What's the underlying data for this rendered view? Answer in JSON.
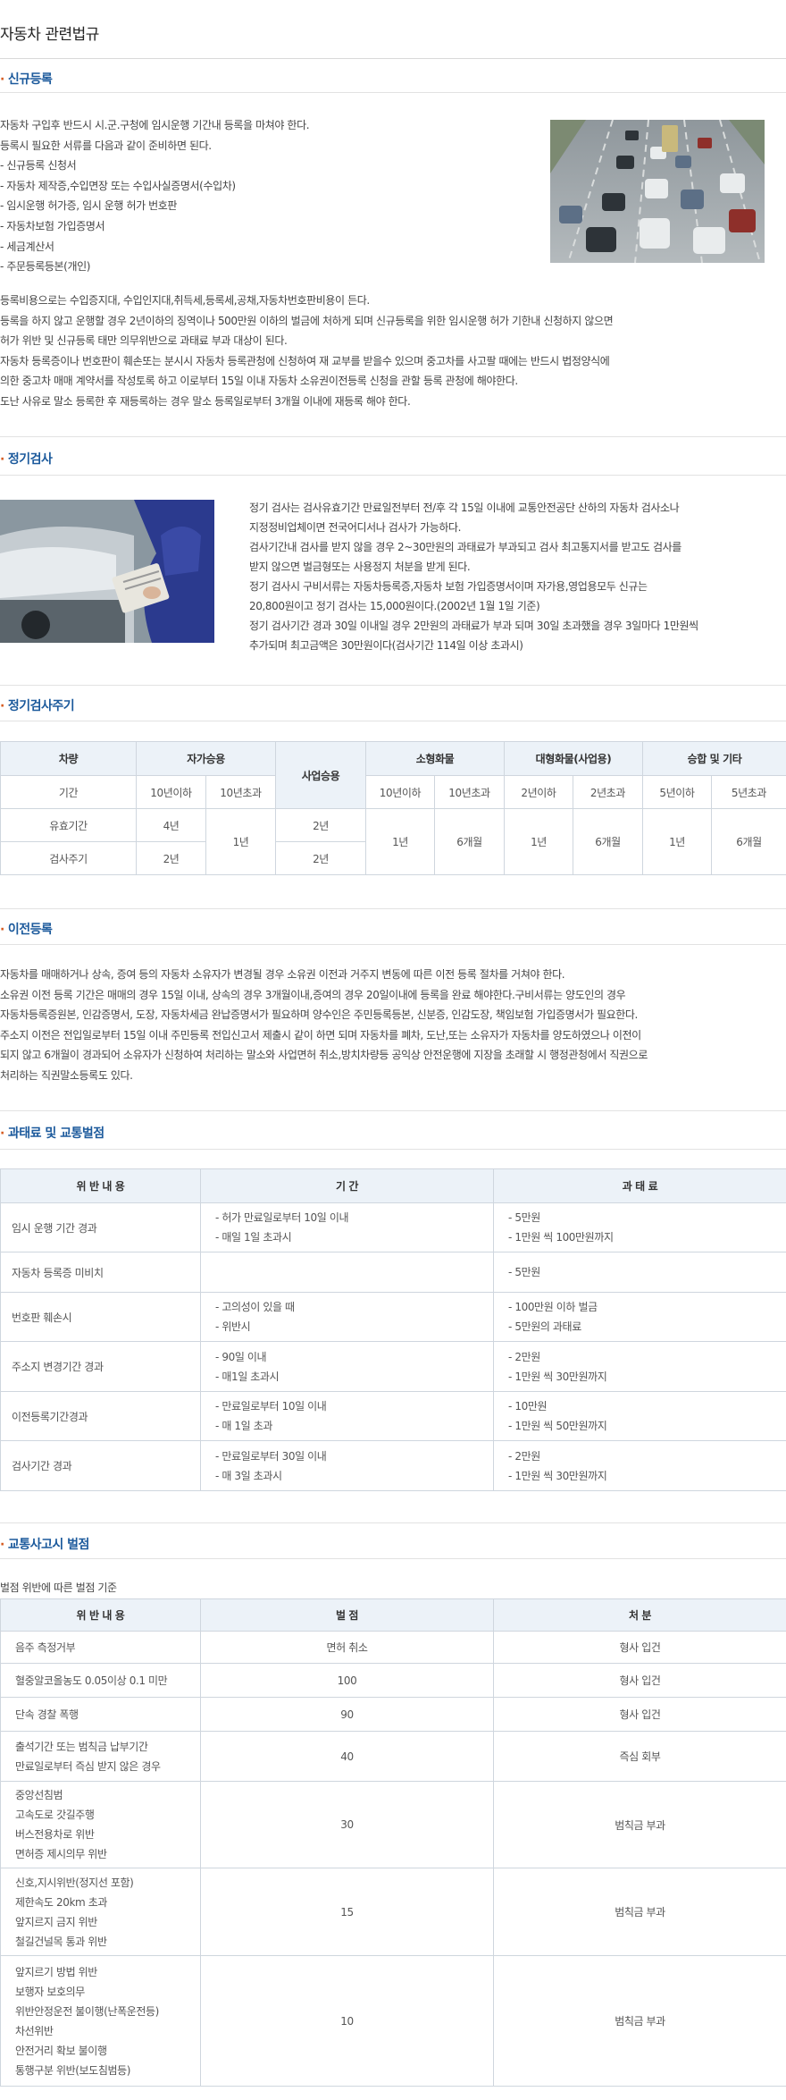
{
  "page_title": "자동차 관련법규",
  "sections": {
    "new_registration": {
      "title": "신규등록",
      "lines_top": [
        "자동차 구입후 반드시 시.군.구청에 임시운행 기간내 등록을 마쳐야 한다.",
        "등록시 필요한 서류를 다음과 같이 준비하면 된다.",
        "- 신규등록 신청서",
        "- 자동차 제작증,수입면장 또는 수입사실증명서(수입차)",
        "- 임시운행 허가증, 임시 운행 허가 번호판",
        "- 자동차보험 가입증명서",
        "- 세금계산서",
        "- 주문등록등본(개인)"
      ],
      "lines_bottom": [
        "등록비용으로는 수입증지대, 수입인지대,취득세,등록세,공채,자동차번호판비용이 든다.",
        "등록을 하지 않고 운행할 경우 2년이하의 징역이나 500만원 이하의 벌금에 처하게 되며 신규등록을 위한 임시운행 허가 기한내 신청하지 않으면",
        "허가 위반 및 신규등록 태만 의무위반으로 과태료 부과 대상이 된다.",
        "자동차 등록증이나 번호판이 훼손또는 분시시 자동차 등록관청에 신청하여 재 교부를 받을수 있으며 중고차를 사고팔 때에는 반드시 법정양식에",
        "의한 중고차 매매 계약서를 작성토록 하고 이로부터 15일 이내 자동차 소유권이전등록 신청을 관할 등록 관청에 해야한다.",
        "도난 사유로 말소 등록한 후 재등록하는 경우 말소 등록일로부터 3개월 이내에 재등록 해야 한다."
      ]
    },
    "inspection": {
      "title": "정기검사",
      "lines": [
        "정기 검사는 검사유효기간 만료일전부터 전/후 각 15일 이내에 교통안전공단 산하의 자동차 검사소나",
        "지정정비업체이면 전국어디서나 검사가 가능하다.",
        "검사기간내 검사를 받지 않을 경우 2~30만원의 과태료가 부과되고 검사 최고통지서를 받고도 검사를",
        "받지 않으면 벌금형또는 사용정지 처분을 받게 된다.",
        "정기 검사시 구비서류는 자동차등록증,자동차 보험 가입증명서이며 자가용,영업용모두 신규는",
        "20,800원이고 정기 검사는 15,000원이다.(2002년 1월 1일 기준)",
        "정기 검사기간 경과 30일 이내일 경우 2만원의 과태료가 부과 되며 30일 초과했을 경우 3일마다 1만원씩",
        "추가되며 최고금액은 30만원이다(검사기간 114일 이상 초과시)"
      ]
    },
    "cycle": {
      "title": "정기검사주기",
      "headers": [
        "차량",
        "자가승용",
        "사업승용",
        "소형화물",
        "대형화물(사업용)",
        "승합 및 기타"
      ],
      "row_period": {
        "label": "기간",
        "cells": [
          "10년이하",
          "10년초과",
          "10년이하",
          "10년초과",
          "2년이하",
          "2년초과",
          "5년이하",
          "5년초과"
        ]
      },
      "row_valid": {
        "label": "유효기간",
        "cells": [
          "4년",
          "1년",
          "2년",
          "1년",
          "6개월",
          "1년",
          "6개월",
          "1년",
          "6개월"
        ]
      },
      "row_cycle": {
        "label": "검사주기",
        "cells": [
          "2년",
          "2년"
        ]
      }
    },
    "transfer": {
      "title": "이전등록",
      "lines": [
        "자동차를 매매하거나 상속, 증여 등의 자동차 소유자가 변경될 경우 소유권 이전과 거주지 변동에 따른 이전 등록 절차를 거쳐야 한다.",
        "소유권 이전 등록 기간은 매매의 경우 15일 이내, 상속의 경우 3개월이내,증여의 경우 20일이내에 등록을 완료 해야한다.구비서류는 양도인의 경우",
        "자동차등록증원본, 인감증명서, 도장, 자동차세금 완납증명서가 필요하며 양수인은 주민등록등본, 신분증, 인감도장, 책임보험 가입증명서가 필요한다.",
        "주소지 이전은 전입일로부터 15일 이내 주민등록 전입신고서 제출시 같이 하면 되며 자동차를 폐차, 도난,또는 소유자가 자동차를 양도하였으나 이전이",
        "되지 않고 6개월이 경과되어 소유자가 신청하여 처리하는 말소와 사업면허 취소,방치차량등 공익상 안전운행에 지장을 초래할 시 행정관청에서 직권으로",
        "처리하는 직권말소등록도 있다."
      ]
    },
    "fines": {
      "title": "과태료 및 교통벌점",
      "headers": [
        "위 반 내 용",
        "기 간",
        "과 태 료"
      ],
      "rows": [
        {
          "item": "임시 운행 기간 경과",
          "period": [
            "- 허가 만료일로부터 10일 이내",
            "- 매일 1일 초과시"
          ],
          "fine": [
            "- 5만원",
            "- 1만원 씩 100만원까지"
          ]
        },
        {
          "item": "자동차 등록증 미비치",
          "period": [],
          "fine": [
            "- 5만원"
          ]
        },
        {
          "item": "번호판 훼손시",
          "period": [
            "- 고의성이 있을 때",
            "- 위반시"
          ],
          "fine": [
            "- 100만원 이하 벌금",
            "- 5만원의 과태료"
          ]
        },
        {
          "item": "주소지 변경기간 경과",
          "period": [
            "- 90일 이내",
            "- 매1일 초과시"
          ],
          "fine": [
            "- 2만원",
            "- 1만원 씩 30만원까지"
          ]
        },
        {
          "item": "이전등록기간경과",
          "period": [
            "- 만료일로부터 10일 이내",
            "- 매 1일 초과"
          ],
          "fine": [
            "- 10만원",
            "- 1만원 씩 50만원까지"
          ]
        },
        {
          "item": "검사기간 경과",
          "period": [
            "- 만료일로부터 30일 이내",
            "- 매 3일 초과시"
          ],
          "fine": [
            "- 2만원",
            "- 1만원 씩 30만원까지"
          ]
        }
      ]
    },
    "penalty": {
      "title": "교통사고시 벌점",
      "caption": "벌점 위반에 따른 벌점 기준",
      "headers": [
        "위 반 내 용",
        "벌 점",
        "처 분"
      ],
      "rows": [
        {
          "items": [
            "음주 측정거부"
          ],
          "points": "면허 취소",
          "action": "형사 입건"
        },
        {
          "items": [
            "혈중알코올농도 0.05이상 0.1 미만"
          ],
          "points": "100",
          "action": "형사 입건"
        },
        {
          "items": [
            "단속 경찰 폭행"
          ],
          "points": "90",
          "action": "형사 입건"
        },
        {
          "items": [
            "출석기간 또는 범칙금 납부기간",
            "만료일로부터 즉심 받지 않은 경우"
          ],
          "points": "40",
          "action": "즉심 회부"
        },
        {
          "items": [
            "중앙선침범",
            "고속도로 갓길주행",
            "버스전용차로 위반",
            "면허증 제시의무 위반"
          ],
          "points": "30",
          "action": "범칙금 부과"
        },
        {
          "items": [
            "신호,지시위반(정지선 포함)",
            "제한속도 20km 초과",
            "앞지르지 금지 위반",
            "철길건널목 통과 위반"
          ],
          "points": "15",
          "action": "범칙금 부과"
        },
        {
          "items": [
            "앞지르기 방법 위반",
            "보행자 보호의무",
            "위반안정운전 불이행(난폭운전등)",
            "차선위반",
            "안전거리 확보 불이행",
            "통행구분 위반(보도침범등)"
          ],
          "points": "10",
          "action": "범칙금 부과"
        }
      ]
    }
  }
}
